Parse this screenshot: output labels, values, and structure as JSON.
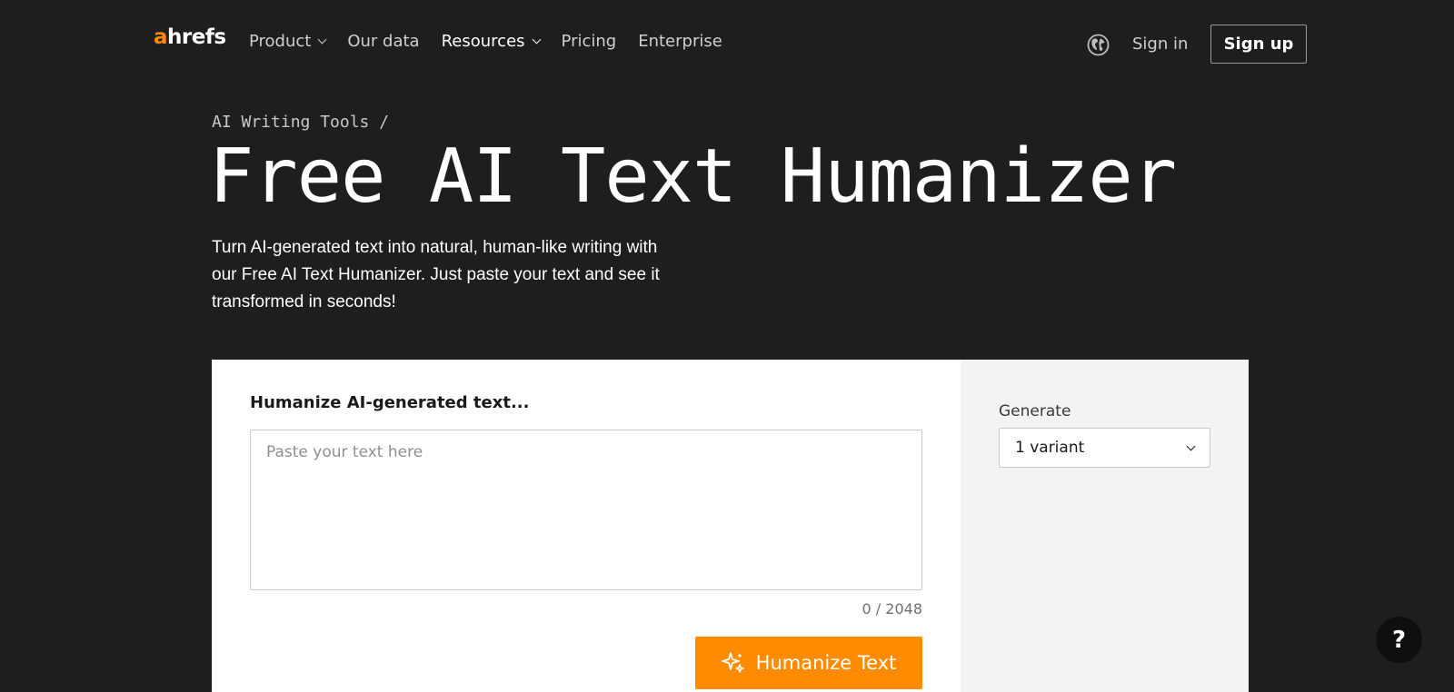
{
  "brand": {
    "logo_first": "a",
    "logo_rest": "hrefs",
    "accent_color": "#ff8c00"
  },
  "nav": {
    "items": [
      {
        "label": "Product",
        "has_dropdown": true
      },
      {
        "label": "Our data",
        "has_dropdown": false
      },
      {
        "label": "Resources",
        "has_dropdown": true
      },
      {
        "label": "Pricing",
        "has_dropdown": false
      },
      {
        "label": "Enterprise",
        "has_dropdown": false
      }
    ],
    "globe_icon": "globe-icon",
    "signin_label": "Sign in",
    "signup_label": "Sign up"
  },
  "hero": {
    "breadcrumb": "AI Writing Tools /",
    "title": "Free AI Text Humanizer",
    "description": "Turn AI-generated text into natural, human-like writing with our Free AI Text Humanizer. Just paste your text and see it transformed in seconds!"
  },
  "tool": {
    "input_label": "Humanize AI-generated text...",
    "placeholder": "Paste your text here",
    "value": "",
    "counter": "0 / 2048",
    "button_label": "Humanize Text",
    "button_icon": "sparkle-icon",
    "generate_label": "Generate",
    "variant_selected": "1 variant"
  },
  "help": {
    "label": "?"
  }
}
